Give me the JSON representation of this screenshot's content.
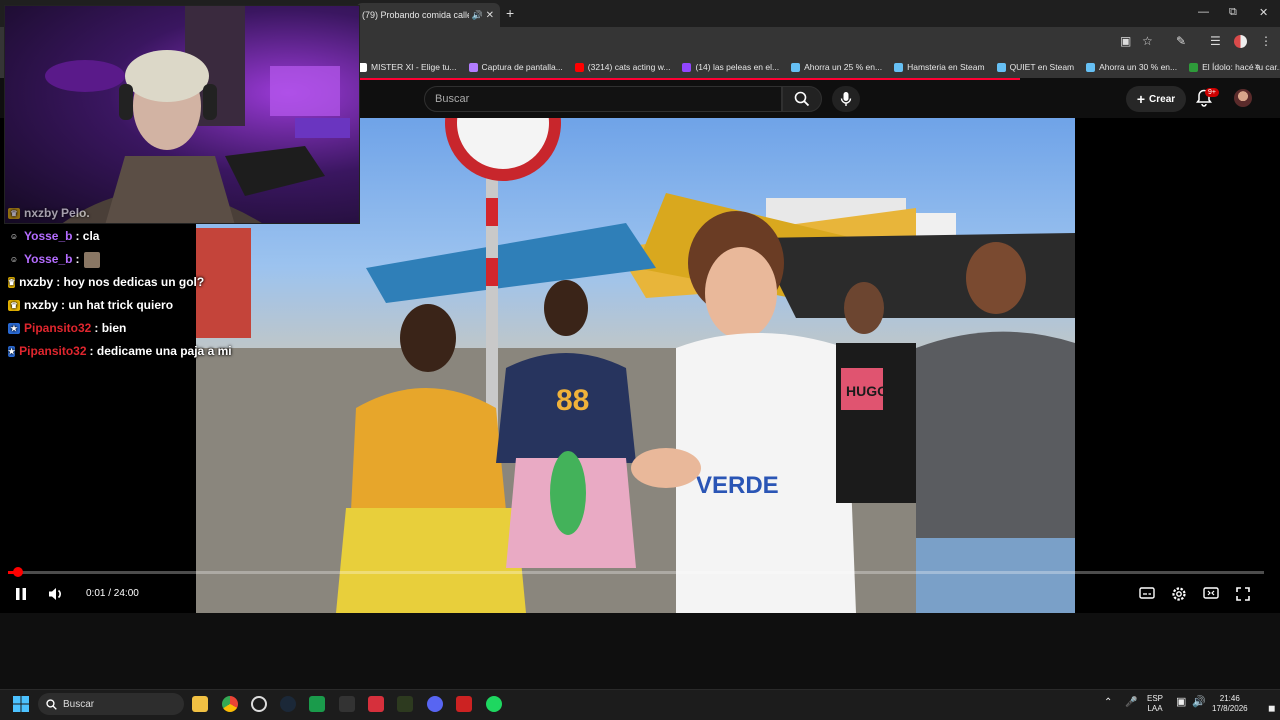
{
  "browser": {
    "tab_title": "(79) Probando comida calle",
    "new_tab_label": "+",
    "window_controls": {
      "minimize": "—",
      "restore": "⧉",
      "close": "✕"
    }
  },
  "bookmarks": [
    {
      "label": "MISTER XI - Elige tu...",
      "color": "#ffffff"
    },
    {
      "label": "Captura de pantalla...",
      "color": "#b27cff"
    },
    {
      "label": "(3214) cats acting w...",
      "color": "#ff0000"
    },
    {
      "label": "(14) las peleas en el...",
      "color": "#9146ff"
    },
    {
      "label": "Ahorra un 25 % en...",
      "color": "#66c0f4"
    },
    {
      "label": "Hamsteria en Steam",
      "color": "#66c0f4"
    },
    {
      "label": "QUIET en Steam",
      "color": "#66c0f4"
    },
    {
      "label": "Ahorra un 30 % en...",
      "color": "#66c0f4"
    },
    {
      "label": "El Ídolo: hacé tu car...",
      "color": "#2e9b3a"
    }
  ],
  "youtube": {
    "search_placeholder": "Buscar",
    "create_label": "Crear",
    "notification_count": "9+"
  },
  "chat": [
    {
      "user": "nxzby",
      "message": "Pelo.",
      "user_color": "#ffffff",
      "badge": "crown",
      "partial": true
    },
    {
      "user": "Yosse_b",
      "message": ": cla",
      "user_color": "#b46cff",
      "badge": "helmet"
    },
    {
      "user": "Yosse_b",
      "message": ":",
      "user_color": "#b46cff",
      "badge": "helmet",
      "emote": true
    },
    {
      "user": "nxzby",
      "message": ": hoy nos dedicas un gol?",
      "user_color": "#ffffff",
      "badge": "crown"
    },
    {
      "user": "nxzby",
      "message": ": un hat trick quiero",
      "user_color": "#ffffff",
      "badge": "crown"
    },
    {
      "user": "Pipansito32",
      "message": ": bien",
      "user_color": "#e0262e",
      "badge": "prime"
    },
    {
      "user": "Pipansito32",
      "message": ": dedicame una paja a mi",
      "user_color": "#e0262e",
      "badge": "prime"
    }
  ],
  "player": {
    "current_time": "0:01",
    "duration": "24:00",
    "time_display": "0:01 / 24:00",
    "progress_fraction": 0.0007
  },
  "video_scene": {
    "shirt_number": "88",
    "shirt_text": "VERDE",
    "tshirt_text": "HUGO"
  },
  "taskbar": {
    "search_label": "Buscar",
    "language": "ESP",
    "layout": "LAA",
    "time": "21:46",
    "date": "17/8/2026"
  }
}
